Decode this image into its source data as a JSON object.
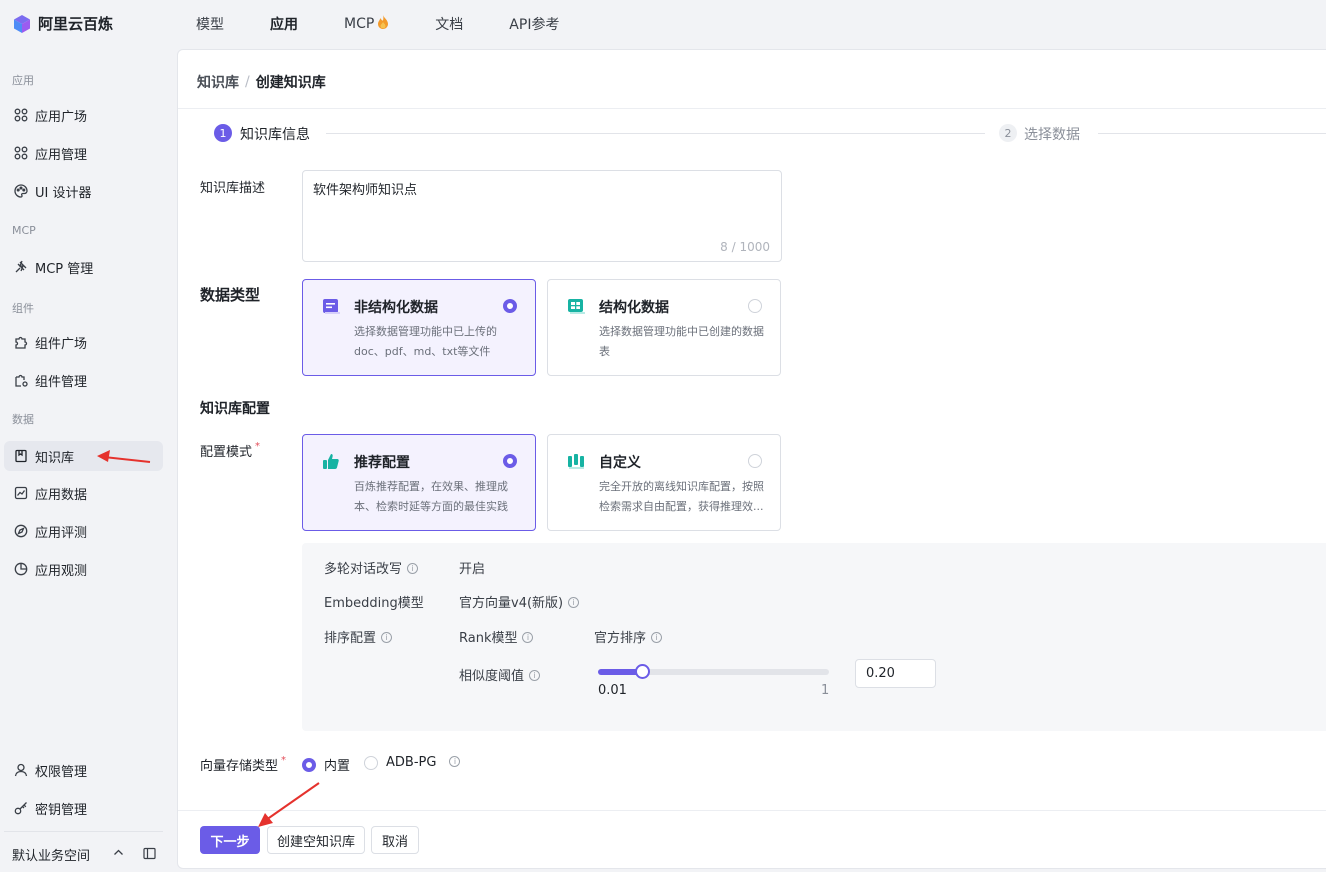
{
  "app": {
    "name": "阿里云百炼"
  },
  "topnav": [
    {
      "label": "模型",
      "active": false
    },
    {
      "label": "应用",
      "active": true
    },
    {
      "label": "MCP",
      "active": false,
      "icon": "fire-icon"
    },
    {
      "label": "文档",
      "active": false
    },
    {
      "label": "API参考",
      "active": false
    }
  ],
  "sidebar": {
    "groups": {
      "app": "应用",
      "mcp": "MCP",
      "component": "组件",
      "data": "数据"
    },
    "items": {
      "app_market": "应用广场",
      "app_manage": "应用管理",
      "ui_designer": "UI 设计器",
      "mcp_manage": "MCP 管理",
      "comp_market": "组件广场",
      "comp_manage": "组件管理",
      "knowledge": "知识库",
      "app_data": "应用数据",
      "app_eval": "应用评测",
      "app_observe": "应用观测",
      "permission": "权限管理",
      "keys": "密钥管理"
    },
    "workspace": "默认业务空间"
  },
  "breadcrumb": {
    "parent": "知识库",
    "separator": "/",
    "current": "创建知识库"
  },
  "steps": [
    {
      "num": "1",
      "label": "知识库信息",
      "active": true
    },
    {
      "num": "2",
      "label": "选择数据",
      "active": false
    }
  ],
  "form": {
    "desc_label": "知识库描述",
    "desc_value": "软件架构师知识点",
    "desc_count": "8 / 1000",
    "data_type_title": "数据类型",
    "data_types": [
      {
        "title": "非结构化数据",
        "desc": "选择数据管理功能中已上传的doc、pdf、md、txt等文件",
        "selected": true
      },
      {
        "title": "结构化数据",
        "desc": "选择数据管理功能中已创建的数据表",
        "selected": false
      }
    ],
    "kb_config_title": "知识库配置",
    "config_mode_label": "配置模式",
    "config_modes": [
      {
        "title": "推荐配置",
        "desc": "百炼推荐配置，在效果、推理成本、检索时延等方面的最佳实践",
        "selected": true
      },
      {
        "title": "自定义",
        "desc": "完全开放的离线知识库配置，按照检索需求自由配置，获得推理效...",
        "selected": false
      }
    ],
    "config_details": {
      "multi_turn_label": "多轮对话改写",
      "multi_turn_value": "开启",
      "embedding_label": "Embedding模型",
      "embedding_value": "官方向量v4(新版)",
      "rank_label": "排序配置",
      "rank_model_label": "Rank模型",
      "rank_model_value": "官方排序",
      "similarity_label": "相似度阈值",
      "similarity_min": "0.01",
      "similarity_max": "1",
      "similarity_value": "0.20",
      "similarity_fraction": 0.19
    },
    "vector_store_label": "向量存储类型",
    "vector_store_options": [
      {
        "label": "内置",
        "selected": true
      },
      {
        "label": "ADB-PG",
        "selected": false
      }
    ]
  },
  "buttons": {
    "next": "下一步",
    "create_empty": "创建空知识库",
    "cancel": "取消"
  },
  "colors": {
    "accent": "#6b5ce7",
    "annotation_arrow": "#e5322d"
  }
}
